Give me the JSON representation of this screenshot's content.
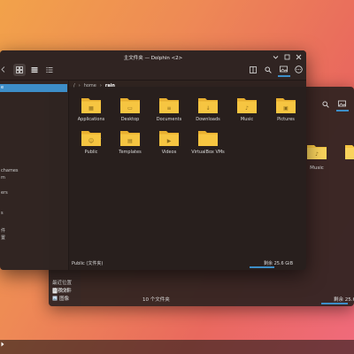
{
  "front": {
    "title": "主文件夹 — Dolphin <2>",
    "breadcrumb": [
      "home",
      "rain"
    ],
    "sidebar_partial": [
      "e",
      "chames",
      "m",
      "ers",
      "s",
      "件",
      "置"
    ],
    "folders": [
      {
        "name": "Applications",
        "emblem": "apps"
      },
      {
        "name": "Desktop",
        "emblem": "desktop"
      },
      {
        "name": "Documents",
        "emblem": "docs"
      },
      {
        "name": "Downloads",
        "emblem": "download"
      },
      {
        "name": "Music",
        "emblem": "music"
      },
      {
        "name": "Pictures",
        "emblem": "pictures"
      },
      {
        "name": "Public",
        "emblem": "public"
      },
      {
        "name": "Templates",
        "emblem": "templates"
      },
      {
        "name": "Videos",
        "emblem": "videos"
      },
      {
        "name": "VirtualBox VMs",
        "emblem": "none"
      }
    ],
    "status_left": "Public (文件夹)",
    "status_right": "剩余 25.6 GiB",
    "accent": "#3d8ec8",
    "folder_color": "#f6c541"
  },
  "back": {
    "sidebar_items": [
      "最近位置",
      "搜索文件",
      "文档",
      "图像"
    ],
    "folders": [
      "Music"
    ],
    "status_center": "10 个文件夹",
    "status_right": "剩余 25.6"
  }
}
